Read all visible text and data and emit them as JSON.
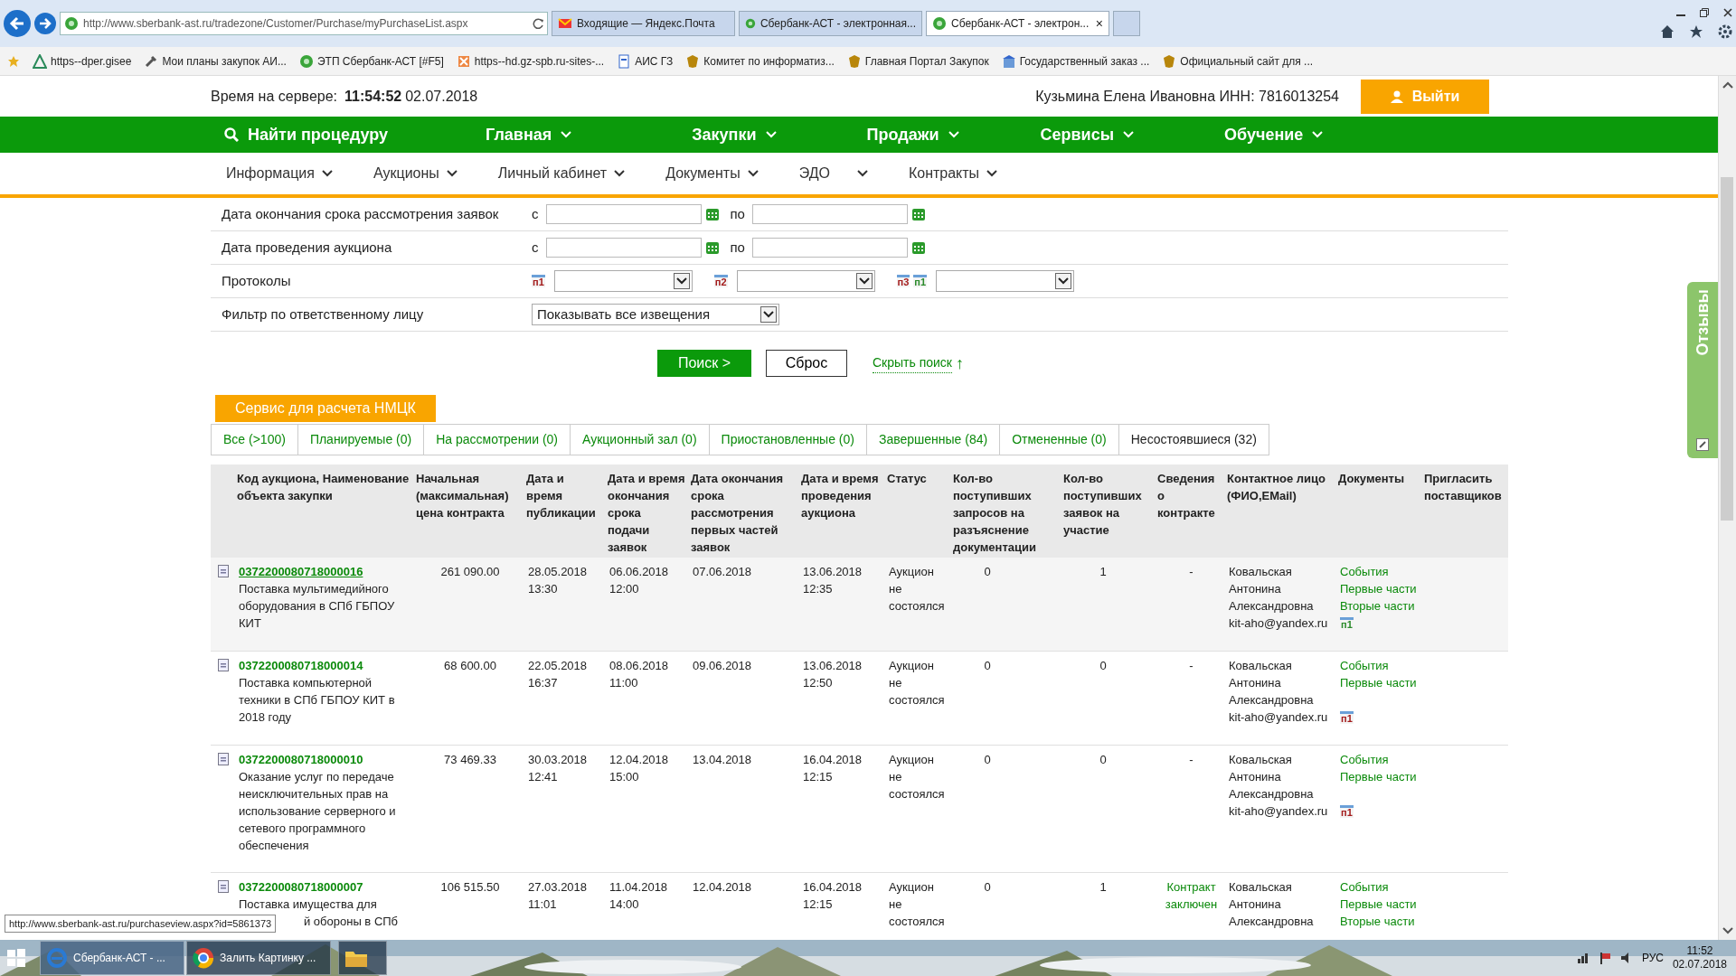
{
  "browser": {
    "address": "http://www.sberbank-ast.ru/tradezone/Customer/Purchase/myPurchaseList.aspx",
    "tabs": [
      {
        "title": "Входящие — Яндекс.Почта",
        "kind": "mail",
        "selected": false
      },
      {
        "title": "Сбербанк-АСТ - электронная...",
        "kind": "site",
        "selected": false
      },
      {
        "title": "Сбербанк-АСТ - электрон...",
        "kind": "site",
        "selected": true,
        "close": "×"
      }
    ],
    "bookmarks": [
      {
        "title": "https--dper.gisee",
        "kind": "triangle"
      },
      {
        "title": "Мои планы закупок АИ...",
        "kind": "tool"
      },
      {
        "title": "ЭТП Сбербанк-АСТ [#F5]",
        "kind": "site"
      },
      {
        "title": "https--hd.gz-spb.ru-sites-...",
        "kind": "red"
      },
      {
        "title": "АИС ГЗ",
        "kind": "page"
      },
      {
        "title": "Комитет по информатиз...",
        "kind": "crest"
      },
      {
        "title": "Главная Портал Закупок",
        "kind": "crest"
      },
      {
        "title": "Государственный заказ ...",
        "kind": "building"
      },
      {
        "title": "Официальный сайт для ...",
        "kind": "crest"
      }
    ]
  },
  "header": {
    "server_time_label": "Время на сервере:",
    "server_time": "11:54:52",
    "server_date": "02.07.2018",
    "user": "Кузьмина Елена Ивановна ИНН: 7816013254",
    "logout": "Выйти"
  },
  "main_nav": [
    {
      "label": "Найти процедуру",
      "kind": "search"
    },
    {
      "label": "Главная",
      "kind": "dropdown"
    },
    {
      "label": "Закупки",
      "kind": "dropdown"
    },
    {
      "label": "Продажи",
      "kind": "dropdown"
    },
    {
      "label": "Сервисы",
      "kind": "dropdown"
    },
    {
      "label": "Обучение",
      "kind": "dropdown"
    }
  ],
  "sub_nav": [
    "Информация",
    "Аукционы",
    "Личный кабинет",
    "Документы",
    "ЭДО",
    "Контракты"
  ],
  "filters": [
    {
      "label": "Дата окончания срока рассмотрения заявок",
      "kind": "date_range",
      "from": "с",
      "to": "по"
    },
    {
      "label": "Дата проведения аукциона",
      "kind": "date_range",
      "from": "с",
      "to": "по"
    },
    {
      "label": "Протоколы",
      "kind": "protocols",
      "selects": [
        {
          "badges": [
            {
              "text": "п1",
              "color": "#a31b1b"
            }
          ]
        },
        {
          "badges": [
            {
              "text": "п2",
              "color": "#a31b1b"
            }
          ]
        },
        {
          "badges": [
            {
              "text": "п3",
              "color": "#a31b1b"
            },
            {
              "text": "п1",
              "color": "#2a8a2a"
            }
          ]
        }
      ]
    },
    {
      "label": "Фильтр по ответственному лицу",
      "kind": "select",
      "value": "Показывать все извещения"
    }
  ],
  "search_actions": {
    "search": "Поиск  >",
    "reset": "Сброс",
    "hide": "Скрыть поиск",
    "hide_icon": "↑"
  },
  "nmck_button": "Сервис для расчета НМЦК",
  "status_tabs": [
    {
      "label": "Все (>100)",
      "selected": false
    },
    {
      "label": "Планируемые (0)",
      "selected": false
    },
    {
      "label": "На рассмотрении (0)",
      "selected": false
    },
    {
      "label": "Аукционный зал (0)",
      "selected": false
    },
    {
      "label": "Приостановленные (0)",
      "selected": false
    },
    {
      "label": "Завершенные (84)",
      "selected": false
    },
    {
      "label": "Отмененные (0)",
      "selected": false
    },
    {
      "label": "Несостоявшиеся (32)",
      "selected": true
    }
  ],
  "table": {
    "columns": [
      "Код аукциона, Наименование объекта закупки",
      "Начальная (максимальная) цена контракта",
      "Дата и время публикации",
      "Дата и время окончания срока подачи заявок",
      "Дата окончания срока рассмотрения первых частей заявок",
      "Дата и время проведения аукциона",
      "Статус",
      "Кол-во поступивших запросов на разъяснение документации",
      "Кол-во поступивших заявок на участие",
      "Сведения о контракте",
      "Контактное лицо (ФИО,EMail)",
      "Документы",
      "Пригласить поставщиков"
    ],
    "rows": [
      {
        "code": "0372200080718000016",
        "hovered": true,
        "description": [
          "Поставка мультимедийного оборудования в СПб ГБПОУ КИТ"
        ],
        "price": "261 090.00",
        "published": [
          "28.05.2018",
          "13:30"
        ],
        "bids_end": [
          "06.06.2018",
          "12:00"
        ],
        "review_end": "07.06.2018",
        "auction": [
          "13.06.2018",
          "12:35"
        ],
        "status": "Аукцион не состоялся",
        "requests": "0",
        "bids": "1",
        "contract": {
          "text": "-",
          "kind": "none"
        },
        "contact": "Ковальская Антонина Александровна",
        "email": "kit-aho@yandex.ru",
        "documents": [
          "События",
          "Первые части",
          "Вторые части"
        ],
        "doc_badge": {
          "text": "п1",
          "color": "#2a8a2a"
        }
      },
      {
        "code": "0372200080718000014",
        "hovered": false,
        "description": [
          "Поставка компьютерной техники в СПб ГБПОУ КИТ в 2018 году"
        ],
        "price": "68 600.00",
        "published": [
          "22.05.2018",
          "16:37"
        ],
        "bids_end": [
          "08.06.2018",
          "11:00"
        ],
        "review_end": "09.06.2018",
        "auction": [
          "13.06.2018",
          "12:50"
        ],
        "status": "Аукцион не состоялся",
        "requests": "0",
        "bids": "0",
        "contract": {
          "text": "-",
          "kind": "none"
        },
        "contact": "Ковальская Антонина Александровна",
        "email": "kit-aho@yandex.ru",
        "documents": [
          "События",
          "Первые части"
        ],
        "doc_badge": {
          "text": "п1",
          "color": "#a31b1b"
        }
      },
      {
        "code": "0372200080718000010",
        "hovered": false,
        "description": [
          "Оказание услуг по передаче неисключительных прав на использование серверного и сетевого программного обеспечения"
        ],
        "price": "73 469.33",
        "published": [
          "30.03.2018",
          "12:41"
        ],
        "bids_end": [
          "12.04.2018",
          "15:00"
        ],
        "review_end": "13.04.2018",
        "auction": [
          "16.04.2018",
          "12:15"
        ],
        "status": "Аукцион не состоялся",
        "requests": "0",
        "bids": "0",
        "contract": {
          "text": "-",
          "kind": "none"
        },
        "contact": "Ковальская Антонина Александровна",
        "email": "kit-aho@yandex.ru",
        "documents": [
          "События",
          "Первые части"
        ],
        "doc_badge": {
          "text": "п1",
          "color": "#a31b1b"
        }
      },
      {
        "code": "0372200080718000007",
        "hovered": false,
        "description": [
          "Поставка имущества для",
          "й обороны в СПб"
        ],
        "price": "106 515.50",
        "published": [
          "27.03.2018",
          "11:01"
        ],
        "bids_end": [
          "11.04.2018",
          "14:00"
        ],
        "review_end": "12.04.2018",
        "auction": [
          "16.04.2018",
          "12:15"
        ],
        "status": "Аукцион не состоялся",
        "requests": "0",
        "bids": "1",
        "contract": {
          "text": "Контракт заключен",
          "kind": "link"
        },
        "contact": "Ковальская Антонина Александровна",
        "documents": [
          "События",
          "Первые части",
          "Вторые части"
        ]
      }
    ]
  },
  "feedback": "Отзывы",
  "status_tooltip": "http://www.sberbank-ast.ru/purchaseview.aspx?id=5861373",
  "taskbar": {
    "apps": [
      {
        "label": "Сбербанк-АСТ - ...",
        "kind": "ie",
        "selected": true
      },
      {
        "label": "Залить Картинку ...",
        "kind": "chrome",
        "selected": false
      },
      {
        "kind": "explorer",
        "selected": false
      }
    ],
    "lang": "РУС",
    "time": "11:52",
    "date": "02.07.2018"
  }
}
